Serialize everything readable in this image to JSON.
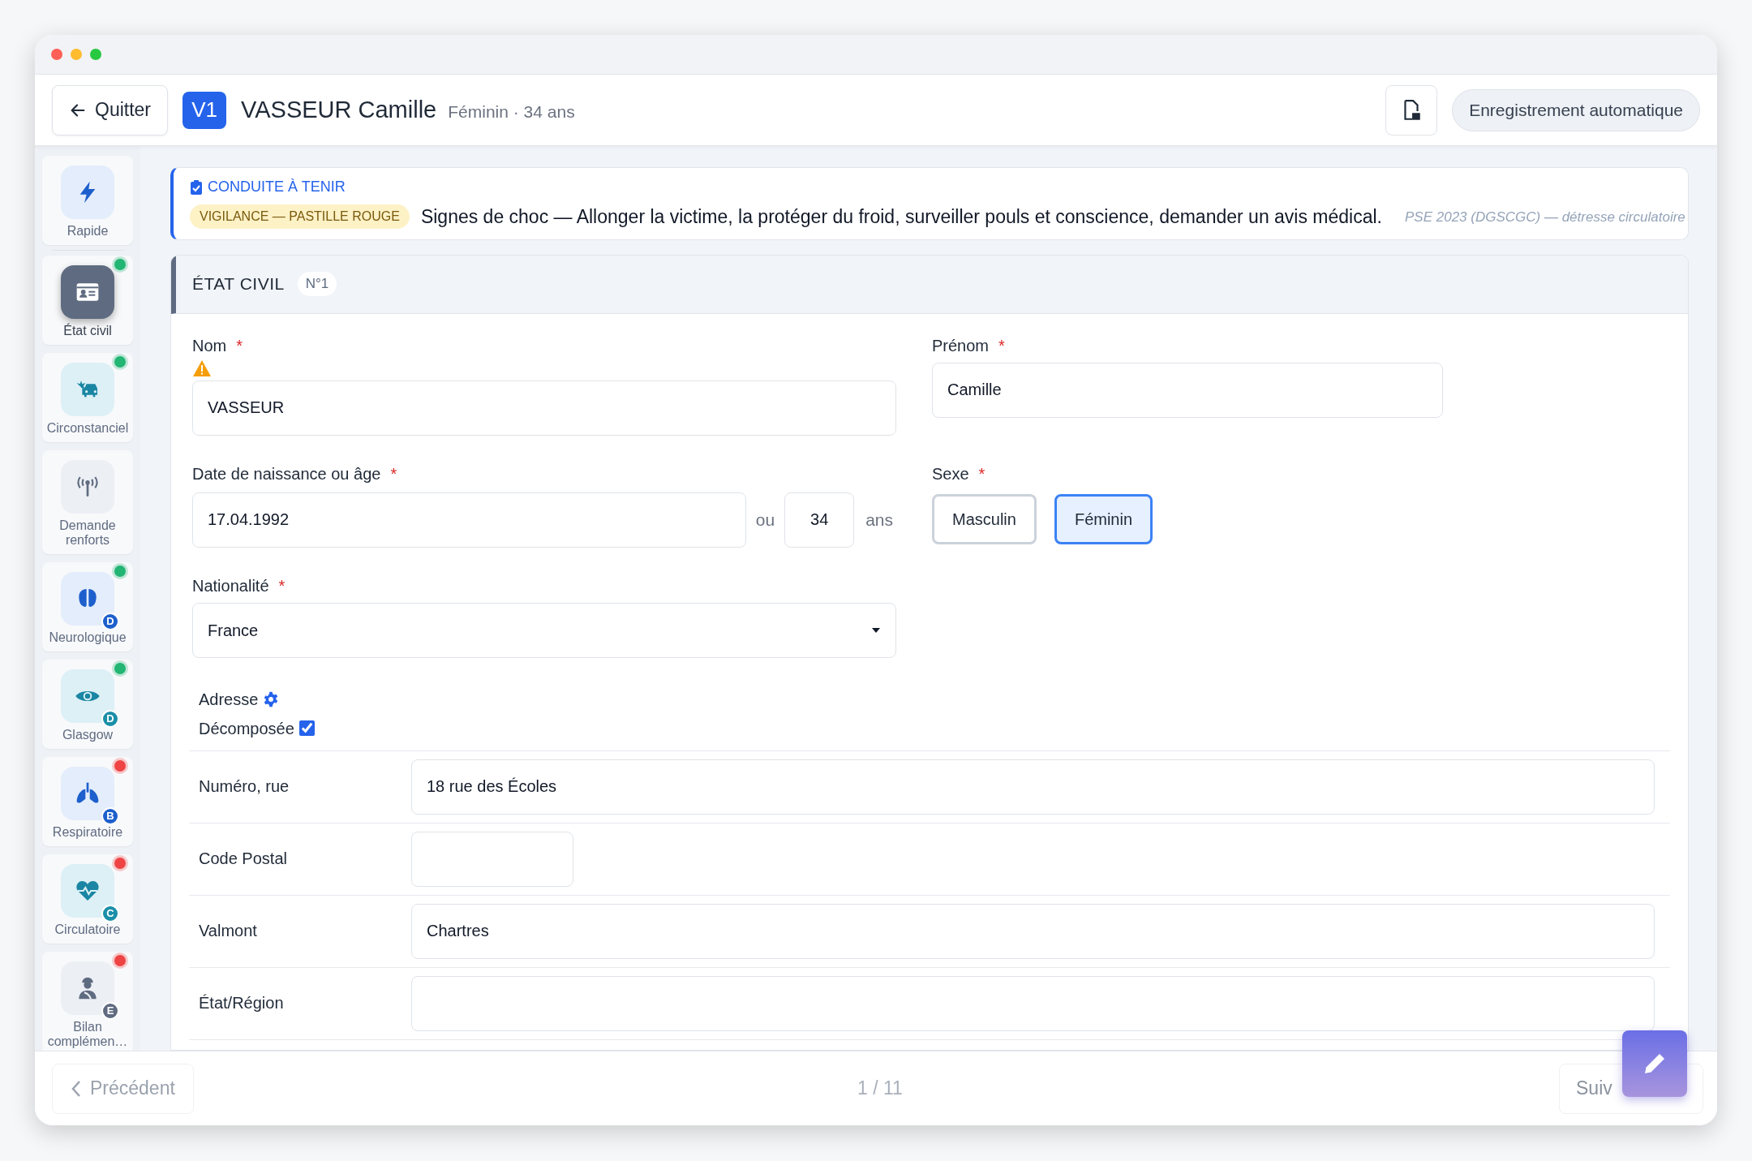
{
  "header": {
    "back_button": "Quitter",
    "victim_badge": "V1",
    "patient_name": "VASSEUR Camille",
    "patient_info": "Féminin · 34 ans",
    "autosave": "Enregistrement automatique"
  },
  "sidebar": {
    "items": [
      {
        "label": "Rapide",
        "selected": false,
        "kind": "blue"
      },
      {
        "label": "État civil",
        "selected": true,
        "kind": "gray",
        "color": "#22b573"
      },
      {
        "label": "Circonstanciel",
        "selected": false,
        "kind": "cyan",
        "color": "#22b573"
      },
      {
        "label": "Demande renforts",
        "selected": false,
        "kind": "gray"
      },
      {
        "label": "Neurologique",
        "selected": false,
        "kind": "blue",
        "color": "#22b573",
        "badge": "D"
      },
      {
        "label": "Glasgow",
        "selected": false,
        "kind": "cyan",
        "color": "#22b573",
        "badge": "D"
      },
      {
        "label": "Respiratoire",
        "selected": false,
        "kind": "blue",
        "color": "#ef4444",
        "badge": "B"
      },
      {
        "label": "Circulatoire",
        "selected": false,
        "kind": "cyan",
        "color": "#ef4444",
        "badge": "C"
      },
      {
        "label": "Bilan complémen…",
        "selected": false,
        "kind": "gray",
        "color": "#ef4444",
        "badge": "E"
      }
    ]
  },
  "banner": {
    "title": "CONDUITE À TENIR",
    "tag": "VIGILANCE — PASTILLE ROUGE",
    "message": "Signes de choc — Allonger la victime, la protéger du froid, surveiller pouls et conscience, demander un avis médical.",
    "source": "PSE 2023 (DGSCGC) — détresse circulatoire"
  },
  "section": {
    "title": "ÉTAT CIVIL",
    "number": "N°1",
    "nom": {
      "label": "Nom",
      "required_mark": "*",
      "warning": true,
      "value": "VASSEUR"
    },
    "prenom": {
      "label": "Prénom",
      "required_mark": "*",
      "value": "Camille"
    },
    "birth": {
      "label": "Date de naissance ou âge",
      "required_mark": "*",
      "date": "17.04.1992",
      "separator": "ou",
      "age": "34",
      "unit": "ans"
    },
    "sexe": {
      "label": "Sexe",
      "required_mark": "*",
      "options": [
        {
          "label": "Masculin",
          "selected": false
        },
        {
          "label": "Féminin",
          "selected": true
        }
      ]
    },
    "nationalite": {
      "label": "Nationalité",
      "required_mark": "*",
      "value": "France"
    },
    "adresse": {
      "label": "Adresse",
      "decomposed_label": "Décomposée",
      "decomposed": true,
      "rows": [
        {
          "label": "Numéro, rue",
          "value": "18 rue des Écoles",
          "kind": "wide"
        },
        {
          "label": "Code Postal",
          "kind": "short"
        },
        {
          "label": "Valmont",
          "value": "Chartres",
          "kind": "wide"
        },
        {
          "label": "État/Région",
          "kind": "wide"
        }
      ]
    }
  },
  "footer": {
    "previous": "Précédent",
    "previous_disabled": true,
    "page": "1 / 11",
    "next": "Suiv"
  }
}
